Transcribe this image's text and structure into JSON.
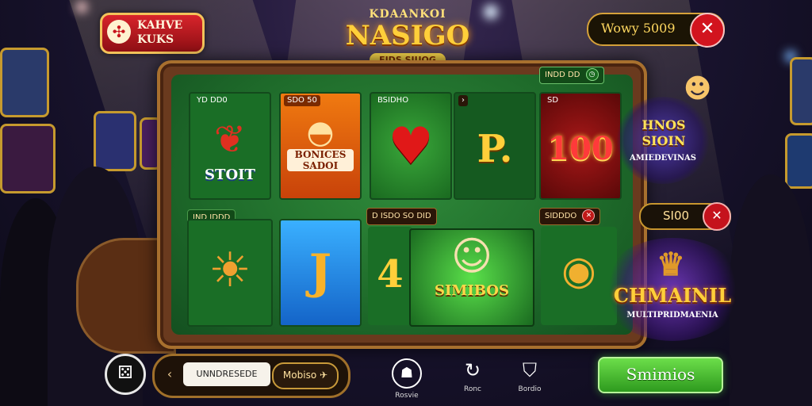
{
  "colors": {
    "felt": "#1e6a2a",
    "frame": "#6a3a1e",
    "gold": "#ffcf3a",
    "red": "#d2141e",
    "play_green": "#3fb82a"
  },
  "top_left_badge": {
    "icon": "clover-icon",
    "line1": "KAHVE",
    "line2": "KUKS"
  },
  "logo": {
    "top": "KDAANKOI",
    "main": "NASIGO",
    "sub": "EIDS SIUOG"
  },
  "win_pill": {
    "label": "Wowy 5009",
    "close_icon": "close-icon"
  },
  "board": {
    "corner_chip": {
      "label": "INDD DD",
      "icon": "clock-icon"
    },
    "tiles_row1": [
      {
        "header": "YD DD0",
        "caption": "STOIT",
        "icon": "leaf-icon"
      },
      {
        "header": "SDO 50",
        "caption": "BONICES SADOI",
        "icon": "food-bowl-icon"
      },
      {
        "header": "BSIDHO",
        "caption": "",
        "icon": "heart-icon"
      },
      {
        "header": "",
        "caption": "P.",
        "icon": "letter-p-icon"
      },
      {
        "header": "SD",
        "caption": "100",
        "icon": "number-100-icon"
      }
    ],
    "tiles_row2": [
      {
        "header": "IND IDDD",
        "caption": "",
        "icon": "lion-icon"
      },
      {
        "header": "",
        "caption": "",
        "icon": "golden-j-icon"
      },
      {
        "header": "",
        "caption": "4",
        "icon": "number-4-icon"
      },
      {
        "header": "",
        "caption": "SIMIBOS",
        "icon": "mascot-icon"
      },
      {
        "header": "SIDDDO",
        "caption": "",
        "icon": "gem-ring-icon"
      }
    ],
    "mid_chip": "D ISDO SO DID",
    "right_chip": "SIDDDO"
  },
  "promo_top": {
    "title": "HNOS SIOIN",
    "subtitle": "AMIEDEVINAS"
  },
  "side_pill": {
    "label": "SI00",
    "close_icon": "close-icon"
  },
  "promo_bottom": {
    "title": "CHMAINIL",
    "subtitle": "MULTIPRIDMAENIA"
  },
  "bottom_bar": {
    "left_icon": "dice-icon",
    "slider_field": "UNNDRESEDE",
    "slider_value": "Mobiso",
    "icons": [
      {
        "icon": "robot-icon",
        "label": "Rosvie"
      },
      {
        "icon": "refresh-icon",
        "label": "Ronc"
      },
      {
        "icon": "shield-icon",
        "label": "Bordio"
      }
    ],
    "play_label": "Smimios"
  }
}
